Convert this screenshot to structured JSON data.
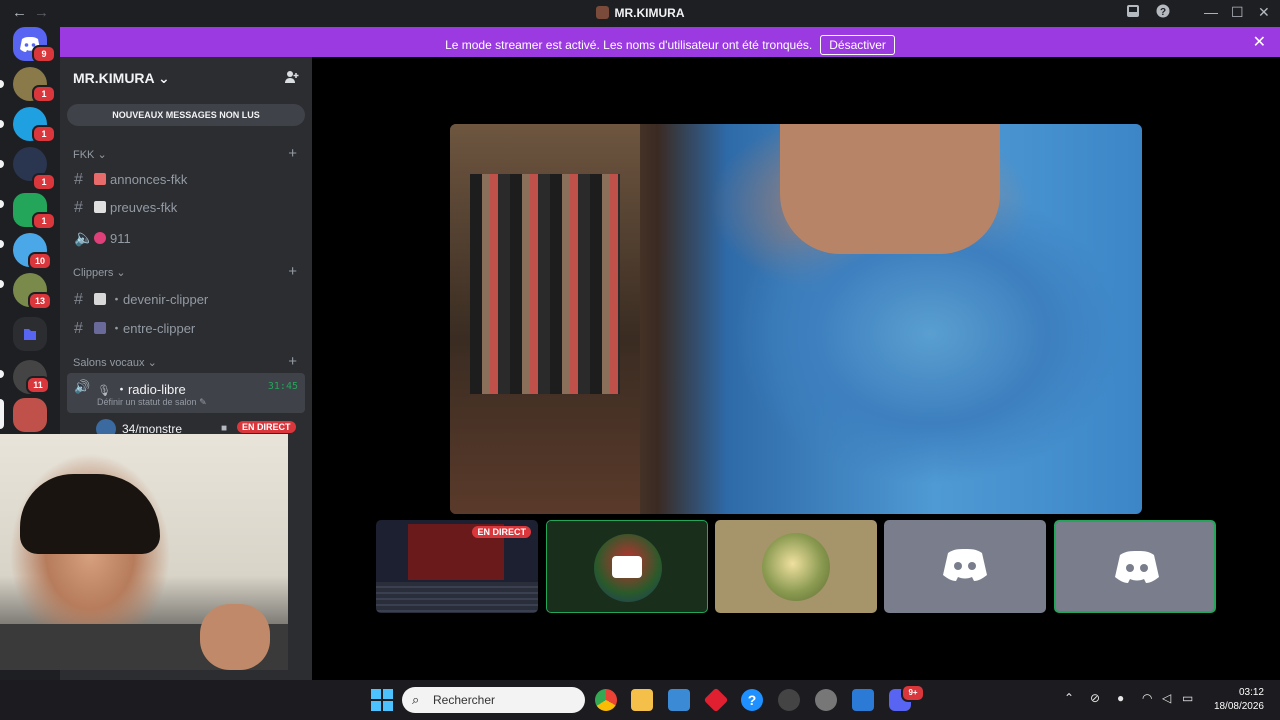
{
  "window": {
    "title": "MR.KIMURA",
    "back": "←",
    "forward": "→"
  },
  "banner": {
    "text": "Le mode streamer est activé. Les noms d'utilisateur ont été tronqués.",
    "button": "Désactiver",
    "close": "✕"
  },
  "guild_badges": [
    "9",
    "1",
    "1",
    "1",
    "1",
    "10",
    "13",
    "11"
  ],
  "server": {
    "name": "MR.KIMURA"
  },
  "new_messages": "NOUVEAUX MESSAGES NON LUS",
  "categories": {
    "fkk": "FKK",
    "clippers": "Clippers",
    "voice": "Salons vocaux"
  },
  "channels": {
    "annonces": "annonces-fkk",
    "preuves": "preuves-fkk",
    "n911": "911",
    "devenir": "・devenir-clipper",
    "entre": "・entre-clipper"
  },
  "voice_channel": {
    "name": "・radio-libre",
    "time": "31:45",
    "status": "Définir un statut de salon",
    "user": "34/monstre",
    "live": "EN DIRECT"
  },
  "tiles": {
    "live": "EN DIRECT"
  },
  "taskbar": {
    "search_placeholder": "Rechercher",
    "discord_badge": "9+",
    "time": "03:12",
    "date": "18/08/2026"
  },
  "colors": {
    "banner": "#9b3ae0",
    "live": "#da373c",
    "active_voice": "#23a55a",
    "discord": "#5865f2"
  }
}
